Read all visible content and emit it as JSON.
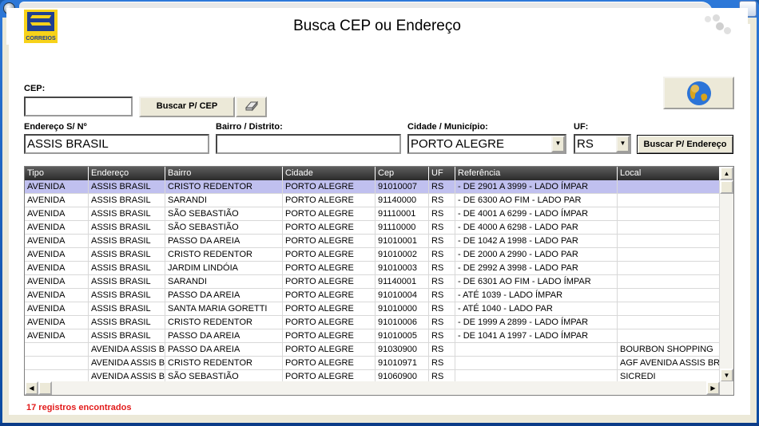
{
  "window": {
    "title": ""
  },
  "header": {
    "logo_text": "CORREIOS",
    "title": "Busca CEP ou Endereço"
  },
  "cep": {
    "label": "CEP:",
    "value": "",
    "search_button": "Buscar P/ CEP",
    "clear_icon": "eraser-icon"
  },
  "endereco": {
    "label": "Endereço S/ Nº",
    "value": "ASSIS BRASIL"
  },
  "bairro": {
    "label": "Bairro / Distrito:",
    "value": ""
  },
  "cidade": {
    "label": "Cidade / Município:",
    "value": "PORTO ALEGRE"
  },
  "uf": {
    "label": "UF:",
    "value": "RS"
  },
  "search_address_button": "Buscar P/ Endereço",
  "globe_icon": "globe-icon",
  "grid": {
    "columns": [
      "Tipo",
      "Endereço",
      "Bairro",
      "Cidade",
      "Cep",
      "UF",
      "Referência",
      "Local"
    ],
    "rows": [
      [
        "AVENIDA",
        "ASSIS BRASIL",
        "CRISTO REDENTOR",
        "PORTO ALEGRE",
        "91010007",
        "RS",
        "- DE 2901 A 3999 - LADO ÍMPAR",
        ""
      ],
      [
        "AVENIDA",
        "ASSIS BRASIL",
        "SARANDI",
        "PORTO ALEGRE",
        "91140000",
        "RS",
        "- DE 6300 AO FIM - LADO PAR",
        ""
      ],
      [
        "AVENIDA",
        "ASSIS BRASIL",
        "SÃO SEBASTIÃO",
        "PORTO ALEGRE",
        "91110001",
        "RS",
        "- DE 4001 A 6299 - LADO ÍMPAR",
        ""
      ],
      [
        "AVENIDA",
        "ASSIS BRASIL",
        "SÃO SEBASTIÃO",
        "PORTO ALEGRE",
        "91110000",
        "RS",
        "- DE 4000 A 6298 - LADO PAR",
        ""
      ],
      [
        "AVENIDA",
        "ASSIS BRASIL",
        "PASSO DA AREIA",
        "PORTO ALEGRE",
        "91010001",
        "RS",
        "- DE 1042 A 1998 - LADO PAR",
        ""
      ],
      [
        "AVENIDA",
        "ASSIS BRASIL",
        "CRISTO REDENTOR",
        "PORTO ALEGRE",
        "91010002",
        "RS",
        "- DE 2000 A 2990 - LADO PAR",
        ""
      ],
      [
        "AVENIDA",
        "ASSIS BRASIL",
        "JARDIM LINDÓIA",
        "PORTO ALEGRE",
        "91010003",
        "RS",
        "- DE 2992 A 3998 - LADO PAR",
        ""
      ],
      [
        "AVENIDA",
        "ASSIS BRASIL",
        "SARANDI",
        "PORTO ALEGRE",
        "91140001",
        "RS",
        "- DE 6301 AO FIM - LADO ÍMPAR",
        ""
      ],
      [
        "AVENIDA",
        "ASSIS BRASIL",
        "PASSO DA AREIA",
        "PORTO ALEGRE",
        "91010004",
        "RS",
        "- ATÉ 1039 - LADO ÍMPAR",
        ""
      ],
      [
        "AVENIDA",
        "ASSIS BRASIL",
        "SANTA MARIA GORETTI",
        "PORTO ALEGRE",
        "91010000",
        "RS",
        "- ATÉ 1040 - LADO PAR",
        ""
      ],
      [
        "AVENIDA",
        "ASSIS BRASIL",
        "CRISTO REDENTOR",
        "PORTO ALEGRE",
        "91010006",
        "RS",
        "- DE 1999 A 2899 - LADO ÍMPAR",
        ""
      ],
      [
        "AVENIDA",
        "ASSIS BRASIL",
        "PASSO DA AREIA",
        "PORTO ALEGRE",
        "91010005",
        "RS",
        "- DE 1041 A 1997 - LADO ÍMPAR",
        ""
      ],
      [
        "",
        "AVENIDA ASSIS BRASIL",
        "PASSO DA AREIA",
        "PORTO ALEGRE",
        "91030900",
        "RS",
        "",
        "BOURBON SHOPPING"
      ],
      [
        "",
        "AVENIDA ASSIS BRASIL",
        "CRISTO REDENTOR",
        "PORTO ALEGRE",
        "91010971",
        "RS",
        "",
        "AGF AVENIDA ASSIS BRASIL"
      ],
      [
        "",
        "AVENIDA ASSIS BRASIL",
        "SÃO SEBASTIÃO",
        "PORTO ALEGRE",
        "91060900",
        "RS",
        "",
        "SICREDI"
      ]
    ]
  },
  "status": "17 registros encontrados"
}
